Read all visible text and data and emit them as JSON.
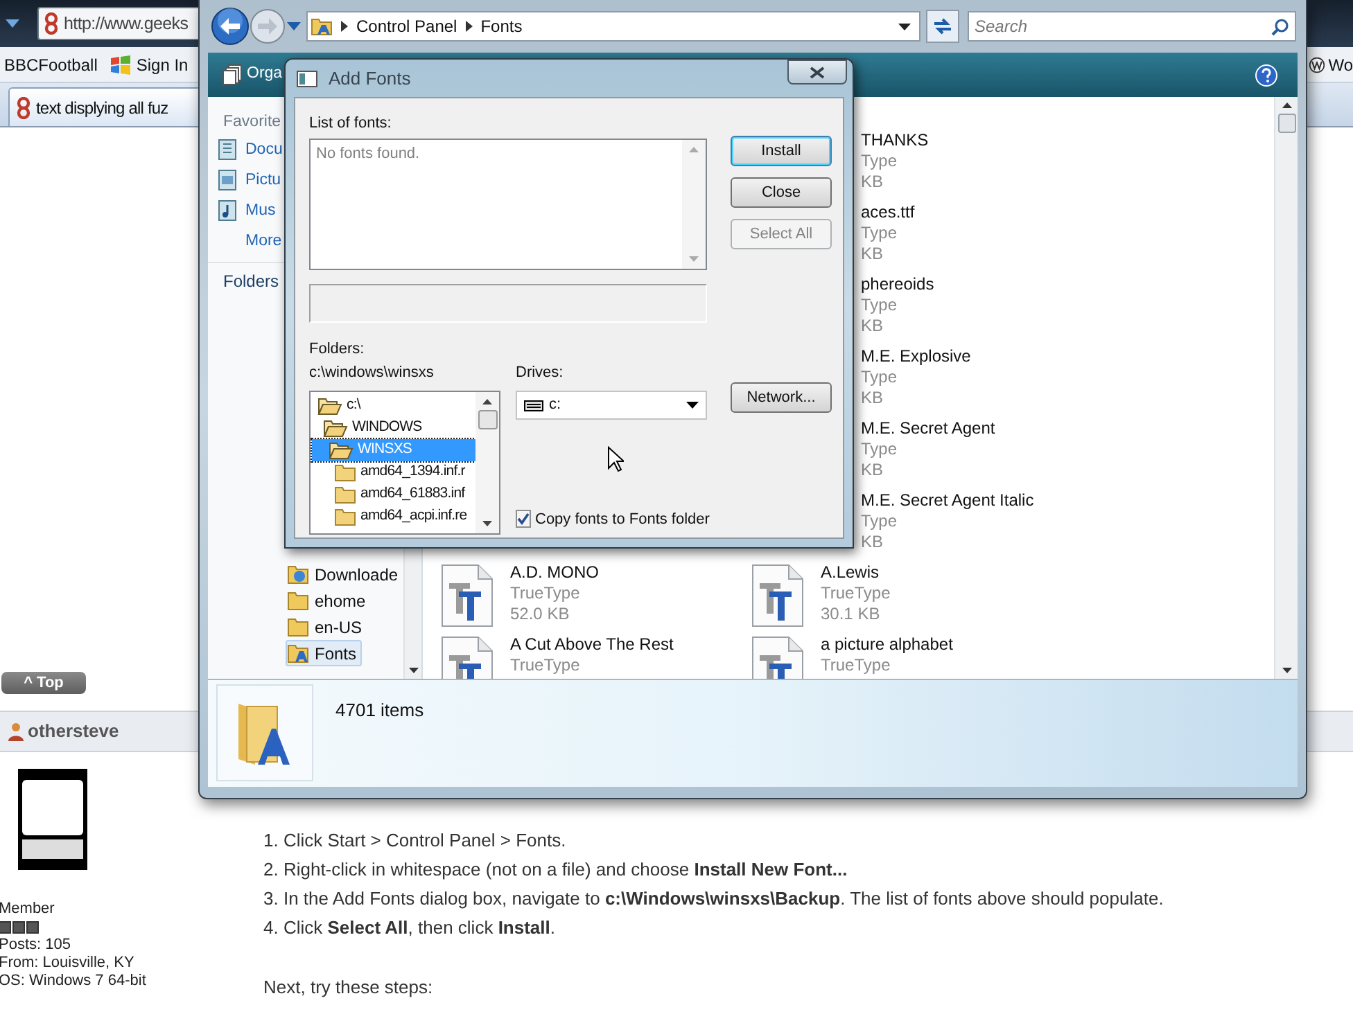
{
  "browser": {
    "address": "http://www.geeks",
    "bookmarks": [
      {
        "label": "BBCFootball"
      },
      {
        "label": "Sign In"
      }
    ],
    "bookmark_right": "Wo",
    "tab": "text displying all fuz"
  },
  "page": {
    "top_button": "^ Top",
    "username": "othersteve",
    "rank": "Member",
    "stars": 3,
    "posts": "Posts: 105",
    "from": "From: Louisville, KY",
    "os": "OS: Windows 7 64-bit",
    "steps": [
      {
        "number": "1.",
        "text": "Click Start > Control Panel > Fonts."
      },
      {
        "number": "2.",
        "text": "Right-click in whitespace (not on a file) and choose **Install New Font...**"
      },
      {
        "number": "3.",
        "text": "In the Add Fonts dialog box, navigate to **c:\\Windows\\winsxs\\Backup**. The list of fonts above should populate."
      },
      {
        "number": "4.",
        "text": "Click **Select All**, then click **Install**."
      }
    ],
    "next": "Next, try these steps:"
  },
  "explorer": {
    "breadcrumb": [
      "Control Panel",
      "Fonts"
    ],
    "search": {
      "placeholder": "Search"
    },
    "toolbar": "Orga",
    "nav": {
      "favorites_heading": "Favorite",
      "favorites": [
        {
          "label": "Docu"
        },
        {
          "label": "Pictu"
        },
        {
          "label": "Mus"
        },
        {
          "label": "More"
        }
      ],
      "folders_heading": "Folders",
      "folders": [
        {
          "label": "Downloade",
          "selected": false
        },
        {
          "label": "ehome",
          "selected": false
        },
        {
          "label": "en-US",
          "selected": false
        },
        {
          "label": "Fonts",
          "selected": true
        }
      ]
    },
    "rows": [
      {
        "right": {
          "name": "THANKS",
          "type": "Type",
          "size": "KB",
          "clipped": true
        }
      },
      {
        "right": {
          "name": "aces.ttf",
          "type": "Type",
          "size": "KB",
          "clipped": true
        }
      },
      {
        "right": {
          "name": "phereoids",
          "type": "Type",
          "size": "KB",
          "clipped": true
        }
      },
      {
        "right": {
          "name": "M.E. Explosive",
          "type": "Type",
          "size": "KB",
          "clipped": true
        }
      },
      {
        "right": {
          "name": "M.E. Secret Agent",
          "type": "Type",
          "size": "KB",
          "clipped": true
        }
      },
      {
        "right": {
          "name": "M.E. Secret Agent Italic",
          "type": "Type",
          "size": "KB",
          "clipped": true
        }
      },
      {
        "left": {
          "name": "A.D. MONO",
          "type": "TrueType",
          "size": "52.0 KB"
        },
        "right": {
          "name": "A.Lewis",
          "type": "TrueType",
          "size": "30.1 KB",
          "clipped": false
        }
      },
      {
        "left": {
          "name": "A Cut Above The Rest",
          "type": "TrueType"
        },
        "right": {
          "name": "a picture alphabet",
          "type": "TrueType",
          "clipped": false
        }
      }
    ],
    "status": "4701 items"
  },
  "dialog": {
    "title": "Add Fonts",
    "list_label": "List of fonts:",
    "list_message": "No fonts found.",
    "folders_label": "Folders:",
    "current_path": "c:\\windows\\winsxs",
    "tree": [
      {
        "label": "c:\\",
        "open": true,
        "selected": false,
        "children": [
          {
            "label": "WINDOWS",
            "open": true,
            "selected": false,
            "children": [
              {
                "label": "WINSXS",
                "open": true,
                "selected": true,
                "children": [
                  {
                    "label": "amd64_1394.inf.r",
                    "open": false,
                    "selected": false
                  },
                  {
                    "label": "amd64_61883.inf",
                    "open": false,
                    "selected": false
                  },
                  {
                    "label": "amd64_acpi.inf.re",
                    "open": false,
                    "selected": false
                  }
                ]
              }
            ]
          }
        ]
      }
    ],
    "drives_label": "Drives:",
    "drive": "c:",
    "buttons": [
      {
        "label": "Install",
        "kind": "default",
        "disabled": false
      },
      {
        "label": "Close",
        "kind": "normal",
        "disabled": false
      },
      {
        "label": "Select All",
        "kind": "normal",
        "disabled": true
      }
    ],
    "network_button": "Network...",
    "copy_checkbox": {
      "label": "Copy fonts to Fonts folder",
      "checked": true
    }
  }
}
